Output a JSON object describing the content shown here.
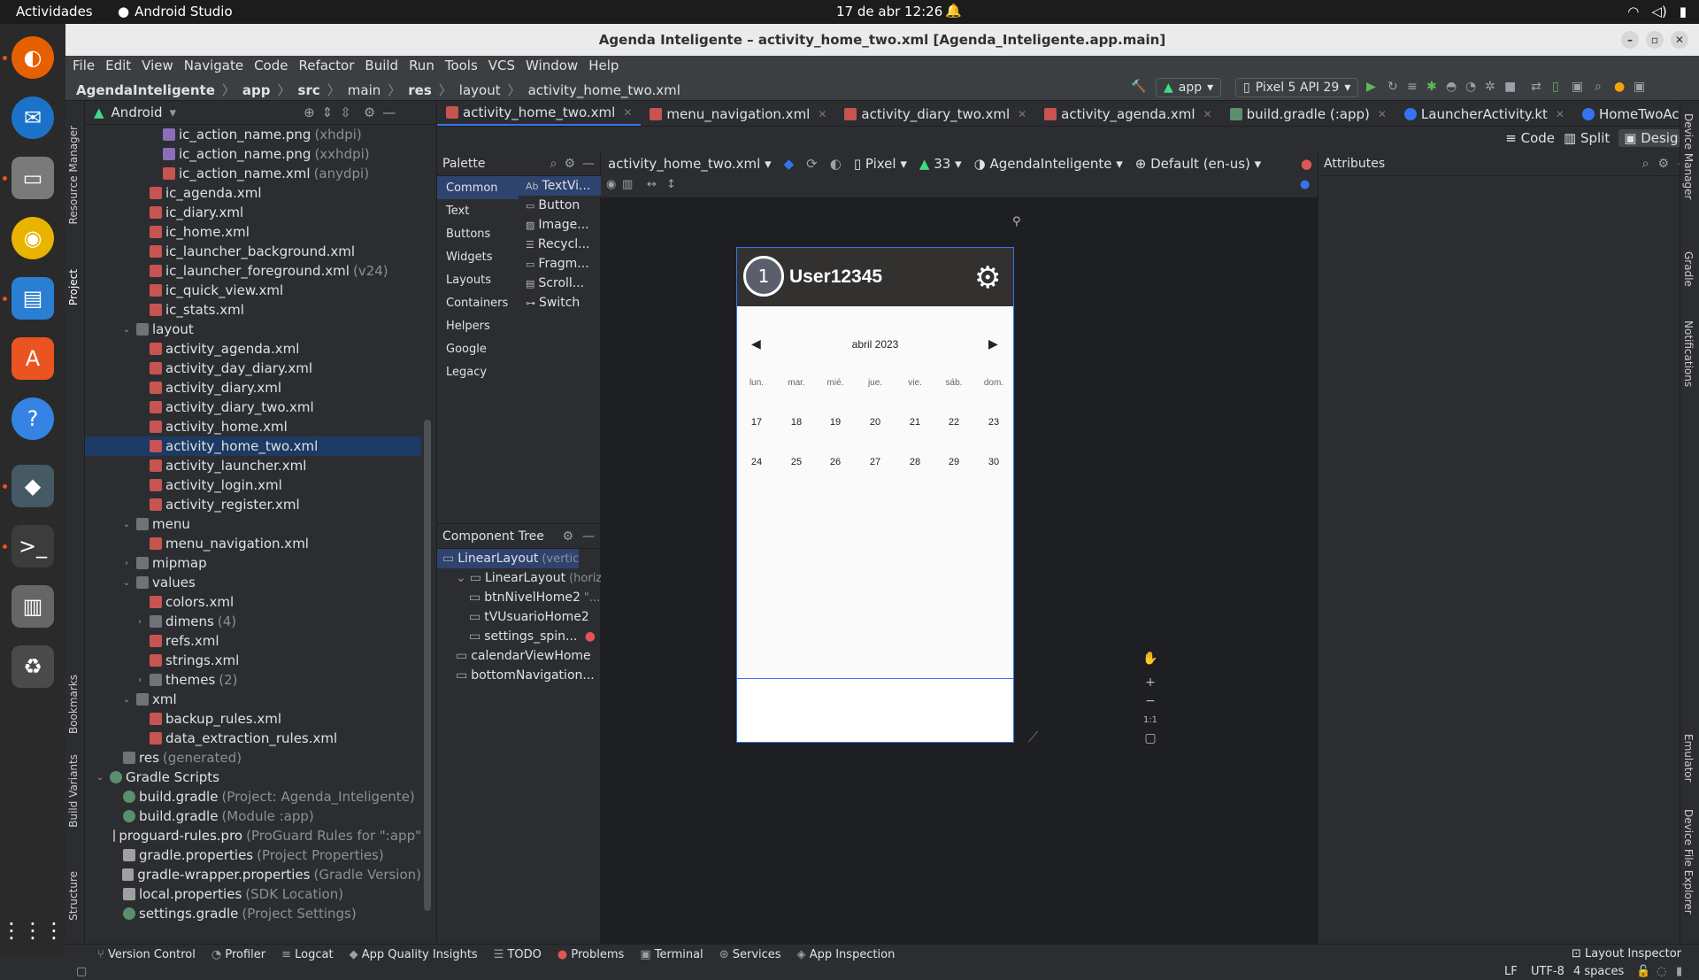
{
  "topbar": {
    "activities": "Actividades",
    "app": "Android Studio",
    "clock": "17 de abr  12:26"
  },
  "window": {
    "title": "Agenda Inteligente – activity_home_two.xml [Agenda_Inteligente.app.main]"
  },
  "menu": [
    "File",
    "Edit",
    "View",
    "Navigate",
    "Code",
    "Refactor",
    "Build",
    "Run",
    "Tools",
    "VCS",
    "Window",
    "Help"
  ],
  "breadcrumbs": [
    "AgendaInteligente",
    "app",
    "src",
    "main",
    "res",
    "layout",
    "activity_home_two.xml"
  ],
  "toolbar": {
    "config": "app",
    "device": "Pixel 5 API 29"
  },
  "project": {
    "view": "Android",
    "rows": [
      {
        "indent": 4,
        "icon": "png",
        "name": "ic_action_name.png",
        "note": "(xhdpi)"
      },
      {
        "indent": 4,
        "icon": "png",
        "name": "ic_action_name.png",
        "note": "(xxhdpi)"
      },
      {
        "indent": 4,
        "icon": "xml",
        "name": "ic_action_name.xml",
        "note": "(anydpi)"
      },
      {
        "indent": 3,
        "icon": "xml",
        "name": "ic_agenda.xml",
        "note": ""
      },
      {
        "indent": 3,
        "icon": "xml",
        "name": "ic_diary.xml",
        "note": ""
      },
      {
        "indent": 3,
        "icon": "xml",
        "name": "ic_home.xml",
        "note": ""
      },
      {
        "indent": 3,
        "icon": "xml",
        "name": "ic_launcher_background.xml",
        "note": ""
      },
      {
        "indent": 3,
        "icon": "xml",
        "name": "ic_launcher_foreground.xml",
        "note": "(v24)"
      },
      {
        "indent": 3,
        "icon": "xml",
        "name": "ic_quick_view.xml",
        "note": ""
      },
      {
        "indent": 3,
        "icon": "xml",
        "name": "ic_stats.xml",
        "note": ""
      },
      {
        "indent": 2,
        "icon": "fold",
        "arrow": "open",
        "name": "layout",
        "note": ""
      },
      {
        "indent": 3,
        "icon": "xml",
        "name": "activity_agenda.xml",
        "note": ""
      },
      {
        "indent": 3,
        "icon": "xml",
        "name": "activity_day_diary.xml",
        "note": ""
      },
      {
        "indent": 3,
        "icon": "xml",
        "name": "activity_diary.xml",
        "note": ""
      },
      {
        "indent": 3,
        "icon": "xml",
        "name": "activity_diary_two.xml",
        "note": ""
      },
      {
        "indent": 3,
        "icon": "xml",
        "name": "activity_home.xml",
        "note": ""
      },
      {
        "indent": 3,
        "icon": "xml",
        "name": "activity_home_two.xml",
        "note": "",
        "selected": true
      },
      {
        "indent": 3,
        "icon": "xml",
        "name": "activity_launcher.xml",
        "note": ""
      },
      {
        "indent": 3,
        "icon": "xml",
        "name": "activity_login.xml",
        "note": ""
      },
      {
        "indent": 3,
        "icon": "xml",
        "name": "activity_register.xml",
        "note": ""
      },
      {
        "indent": 2,
        "icon": "fold",
        "arrow": "open",
        "name": "menu",
        "note": ""
      },
      {
        "indent": 3,
        "icon": "xml",
        "name": "menu_navigation.xml",
        "note": ""
      },
      {
        "indent": 2,
        "icon": "fold",
        "arrow": "closed",
        "name": "mipmap",
        "note": ""
      },
      {
        "indent": 2,
        "icon": "fold",
        "arrow": "open",
        "name": "values",
        "note": ""
      },
      {
        "indent": 3,
        "icon": "xml",
        "name": "colors.xml",
        "note": ""
      },
      {
        "indent": 3,
        "icon": "fold",
        "arrow": "closed",
        "name": "dimens",
        "note": "(4)"
      },
      {
        "indent": 3,
        "icon": "xml",
        "name": "refs.xml",
        "note": ""
      },
      {
        "indent": 3,
        "icon": "xml",
        "name": "strings.xml",
        "note": ""
      },
      {
        "indent": 3,
        "icon": "fold",
        "arrow": "closed",
        "name": "themes",
        "note": "(2)"
      },
      {
        "indent": 2,
        "icon": "fold",
        "arrow": "open",
        "name": "xml",
        "note": ""
      },
      {
        "indent": 3,
        "icon": "xml",
        "name": "backup_rules.xml",
        "note": ""
      },
      {
        "indent": 3,
        "icon": "xml",
        "name": "data_extraction_rules.xml",
        "note": ""
      },
      {
        "indent": 1,
        "icon": "fold",
        "name": "res",
        "note": "(generated)"
      },
      {
        "indent": 0,
        "icon": "gr",
        "arrow": "open",
        "name": "Gradle Scripts",
        "note": ""
      },
      {
        "indent": 1,
        "icon": "gr",
        "name": "build.gradle",
        "note": "(Project: Agenda_Inteligente)"
      },
      {
        "indent": 1,
        "icon": "gr",
        "name": "build.gradle",
        "note": "(Module :app)"
      },
      {
        "indent": 1,
        "icon": "prop",
        "name": "proguard-rules.pro",
        "note": "(ProGuard Rules for \":app\""
      },
      {
        "indent": 1,
        "icon": "prop",
        "name": "gradle.properties",
        "note": "(Project Properties)"
      },
      {
        "indent": 1,
        "icon": "prop",
        "name": "gradle-wrapper.properties",
        "note": "(Gradle Version)"
      },
      {
        "indent": 1,
        "icon": "prop",
        "name": "local.properties",
        "note": "(SDK Location)"
      },
      {
        "indent": 1,
        "icon": "gr",
        "name": "settings.gradle",
        "note": "(Project Settings)"
      }
    ]
  },
  "left_tools": [
    "Resource Manager",
    "Project",
    "Bookmarks",
    "Build Variants",
    "Structure"
  ],
  "right_tools": [
    "Device Manager",
    "Gradle",
    "Notifications",
    "Emulator",
    "Device File Explorer"
  ],
  "tabs": [
    {
      "label": "activity_home_two.xml",
      "kind": "xml",
      "active": true
    },
    {
      "label": "menu_navigation.xml",
      "kind": "xml"
    },
    {
      "label": "activity_diary_two.xml",
      "kind": "xml"
    },
    {
      "label": "activity_agenda.xml",
      "kind": "xml"
    },
    {
      "label": "build.gradle (:app)",
      "kind": "gr"
    },
    {
      "label": "LauncherActivity.kt",
      "kind": "kt"
    },
    {
      "label": "HomeTwoActivity.kt",
      "kind": "kt"
    }
  ],
  "modes": {
    "code": "Code",
    "split": "Split",
    "design": "Design"
  },
  "palette": {
    "title": "Palette",
    "categories": [
      "Common",
      "Text",
      "Buttons",
      "Widgets",
      "Layouts",
      "Containers",
      "Helpers",
      "Google",
      "Legacy"
    ],
    "items": [
      "TextVi...",
      "Button",
      "Image...",
      "Recycl...",
      "Fragm...",
      "Scroll...",
      "Switch"
    ]
  },
  "component_tree": {
    "title": "Component Tree",
    "rows": [
      {
        "indent": 0,
        "name": "LinearLayout",
        "note": "(vertical)",
        "selected": true
      },
      {
        "indent": 1,
        "name": "LinearLayout",
        "note": "(horiz...",
        "arrow": true
      },
      {
        "indent": 2,
        "name": "btnNivelHome2",
        "note": "\"..."
      },
      {
        "indent": 2,
        "name": "tVUsuarioHome2",
        "note": ""
      },
      {
        "indent": 2,
        "name": "settings_spin...",
        "note": "",
        "error": true
      },
      {
        "indent": 1,
        "name": "calendarViewHome",
        "note": ""
      },
      {
        "indent": 1,
        "name": "bottomNavigation...",
        "note": ""
      }
    ]
  },
  "design_toolbar": {
    "file": "activity_home_two.xml",
    "device": "Pixel",
    "api": "33",
    "theme": "AgendaInteligente",
    "locale": "Default (en-us)"
  },
  "attributes": {
    "title": "Attributes"
  },
  "phone": {
    "level": "1",
    "user": "User12345",
    "month": "abril 2023",
    "weekdays": [
      "lun.",
      "mar.",
      "mié.",
      "jue.",
      "vie.",
      "sáb.",
      "dom."
    ],
    "week1": [
      "17",
      "18",
      "19",
      "20",
      "21",
      "22",
      "23"
    ],
    "week2": [
      "24",
      "25",
      "26",
      "27",
      "28",
      "29",
      "30"
    ]
  },
  "bottom_tools": [
    "Version Control",
    "Profiler",
    "Logcat",
    "App Quality Insights",
    "TODO",
    "Problems",
    "Terminal",
    "Services",
    "App Inspection"
  ],
  "layout_inspector": "Layout Inspector",
  "status": {
    "lf": "LF",
    "enc": "UTF-8",
    "indent": "4 spaces"
  },
  "zoom": {
    "fit": "1:1"
  }
}
